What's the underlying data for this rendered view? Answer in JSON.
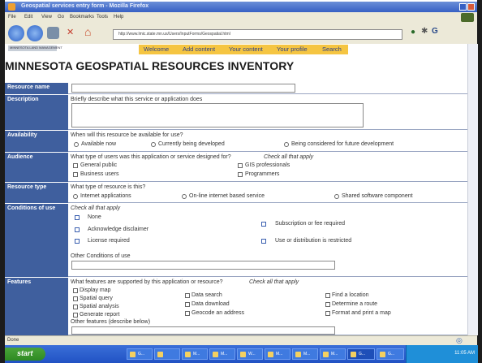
{
  "window": {
    "title": "Geospatial services entry form - Mozilla Firefox"
  },
  "menu": [
    "File",
    "Edit",
    "View",
    "Go",
    "Bookmarks",
    "Tools",
    "Help"
  ],
  "url": "http://www.lmic.state.mn.us/Users/InputForms/Geospatial.html",
  "site_logo_text": "MINNESOTA LAND MANAGEMENT",
  "nav_links": [
    "Welcome",
    "Add content",
    "Your content",
    "Your profile",
    "Search"
  ],
  "heading": "MINNESOTA GEOSPATIAL RESOURCES INVENTORY",
  "form": {
    "resource_name": {
      "label": "Resource name",
      "value": ""
    },
    "description": {
      "label": "Description",
      "prompt": "Briefly describe what this service or application does"
    },
    "availability": {
      "label": "Availability",
      "prompt": "When will this resource be available for use?",
      "options": [
        "Available now",
        "Currently being developed",
        "Being considered for future development"
      ]
    },
    "audience": {
      "label": "Audience",
      "prompt": "What type of users was this application or service designed for?",
      "hint": "Check all that apply",
      "options": [
        "General public",
        "GIS professionals",
        "Business users",
        "Programmers"
      ]
    },
    "resource_type": {
      "label": "Resource type",
      "prompt": "What type of resource is this?",
      "options": [
        "Internet applications",
        "On-line internet based service",
        "Shared software component"
      ]
    },
    "conditions": {
      "label": "Conditions of use",
      "hint": "Check all that apply",
      "options": [
        "None",
        "Acknowledge disclaimer",
        "License required",
        "Subscription or fee required",
        "Use or distribution is restricted"
      ],
      "other_label": "Other Conditions of use"
    },
    "features": {
      "label": "Features",
      "prompt": "What features are supported by this application or resource?",
      "hint": "Check all that apply",
      "options": [
        "Display map",
        "Spatial query",
        "Spatial analysis",
        "Generate report",
        "Data search",
        "Data download",
        "Geocode an address",
        "Find a location",
        "Determine a route",
        "Format and print a map"
      ],
      "other_label": "Other features (describe below)"
    }
  },
  "status": "Done",
  "taskbar": {
    "start": "start",
    "items": [
      "G...",
      "",
      "M...",
      "M...",
      "W...",
      "M...",
      "M...",
      "M...",
      "G...",
      "G..."
    ],
    "clock": "11:05 AM"
  }
}
